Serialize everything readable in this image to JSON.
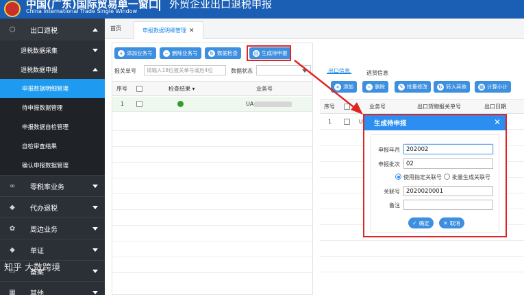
{
  "header": {
    "org_cn": "中国(广东)国际贸易单一窗口",
    "org_en": "China International Trade Single Window",
    "system_name": "外贸企业出口退税申报"
  },
  "sidebar": {
    "top_item": "出口退税",
    "sub_items": [
      {
        "label": "退税数据采集",
        "caret": "down"
      },
      {
        "label": "退税数据申报",
        "caret": "up"
      }
    ],
    "leaf_items": [
      "申报数据明细管理",
      "待申报数据管理",
      "申报数据自检管理",
      "自检审查结果",
      "确认申报数据管理"
    ],
    "active_leaf": "申报数据明细管理",
    "groups": [
      {
        "label": "零税率业务",
        "icon": "∞"
      },
      {
        "label": "代办退税",
        "icon": "◆"
      },
      {
        "label": "周边业务",
        "icon": "✿"
      },
      {
        "label": "单证",
        "icon": "◆"
      },
      {
        "label": "备案",
        "icon": "▭"
      },
      {
        "label": "其他",
        "icon": "▦"
      }
    ],
    "watermark": "知乎 大数跨境"
  },
  "tabs": {
    "home": "首页",
    "active": "申报数据明细管理"
  },
  "left_panel": {
    "toolbar": {
      "add": "添加业务号",
      "delete": "删除业务号",
      "check": "数据检查",
      "generate": "生成待申报"
    },
    "filter": {
      "customs_label": "报关单号",
      "customs_placeholder": "请输入18位报关单号或后4位",
      "status_label": "数据状态"
    },
    "grid": {
      "headers": [
        "序号",
        "检查结果",
        "业务号"
      ],
      "rows": [
        {
          "index": "1",
          "business_no": "UA"
        }
      ]
    }
  },
  "right_panel": {
    "tabs": [
      "出口信息",
      "进货信息"
    ],
    "active_tab": "出口信息",
    "toolbar": [
      "添加",
      "删除",
      "批量修改",
      "转入其他",
      "计算小计"
    ],
    "grid": {
      "headers": [
        "序号",
        "业务号",
        "出口货物报关单号",
        "出口日期"
      ],
      "rows": [
        {
          "index": "1",
          "business_no": "U"
        }
      ]
    }
  },
  "dialog": {
    "title": "生成待申报",
    "fields": {
      "period_label": "申报年月",
      "period_value": "202002",
      "batch_label": "申报批次",
      "batch_value": "02",
      "radio_specified": "使用指定关联号",
      "radio_batch": "批量生成关联号",
      "link_label": "关联号",
      "link_value": "2020020001",
      "note_label": "备注",
      "note_value": ""
    },
    "confirm": "确定",
    "cancel": "取消"
  },
  "colors": {
    "header_bg": "#1a5fb4",
    "sidebar_bg": "#2b2f36",
    "active_item": "#1e9bf0",
    "button": "#3d8fe0",
    "highlight": "#e02424",
    "dialog_title": "#2b8ef0"
  }
}
